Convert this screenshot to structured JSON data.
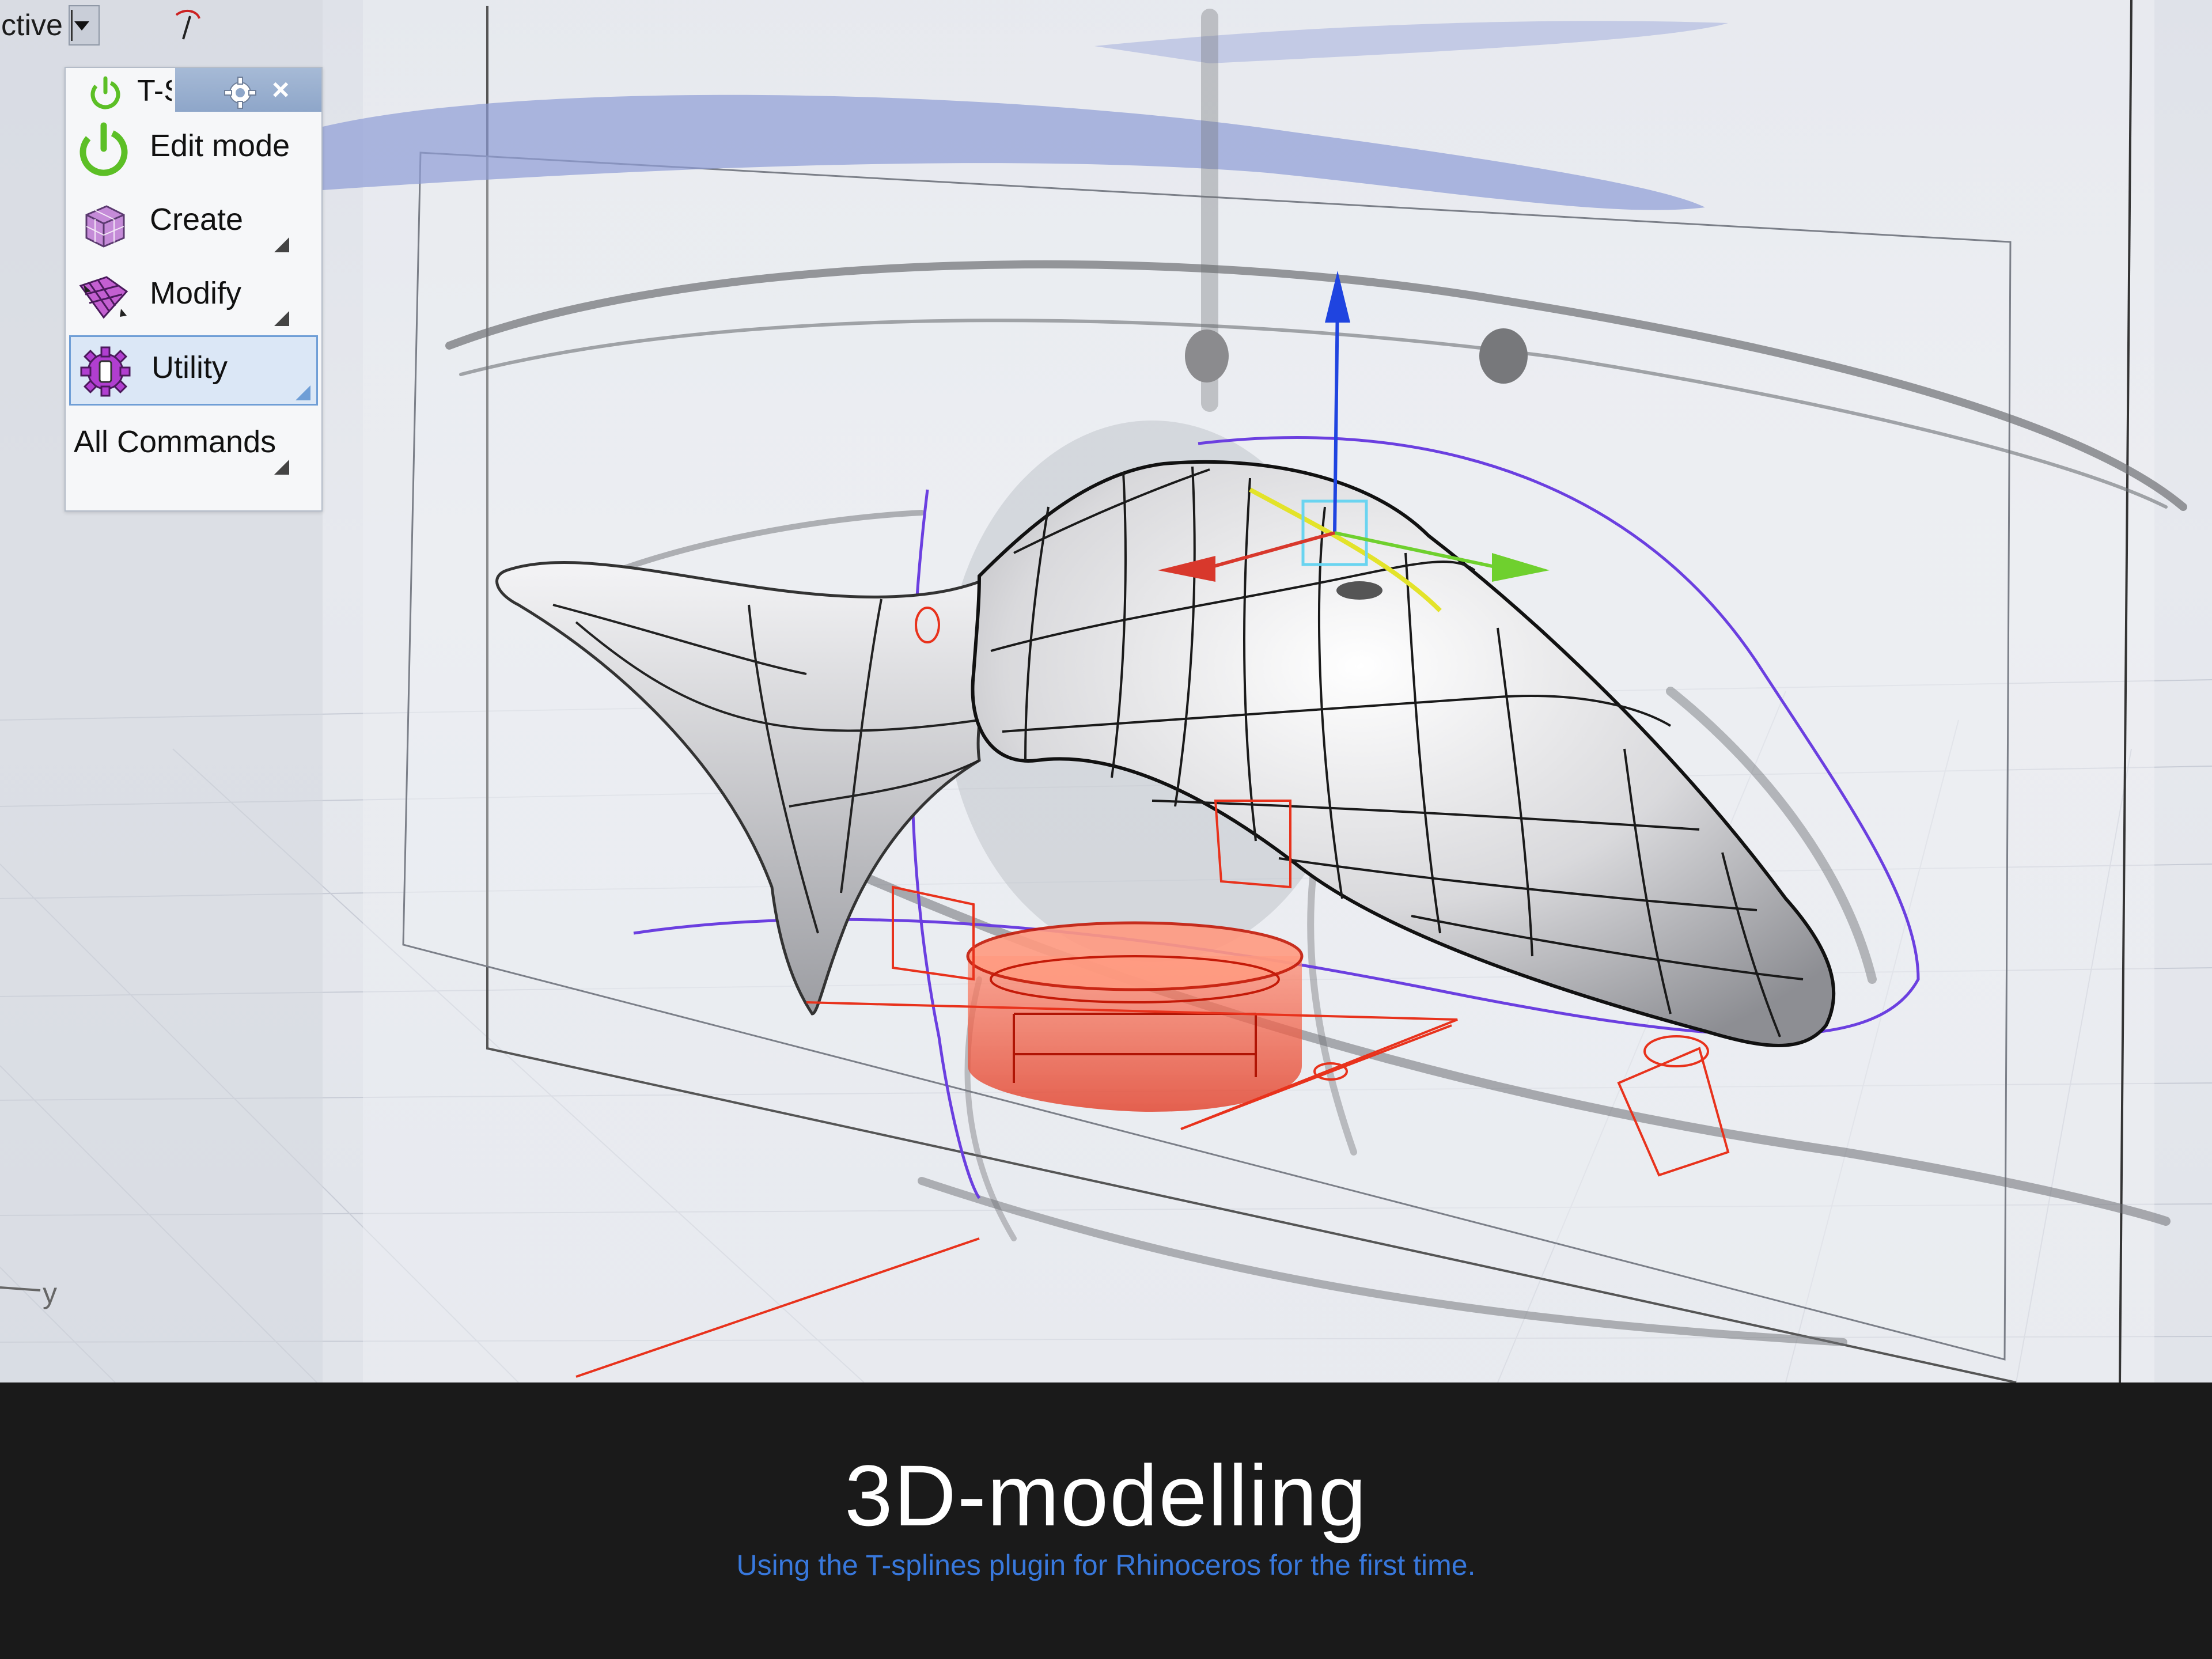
{
  "viewport": {
    "title_fragment": "ctive",
    "axis_label": "y"
  },
  "toolbar": {
    "title": "T-S",
    "close_symbol": "×",
    "items": [
      {
        "label": "Edit mode",
        "icon": "power-icon"
      },
      {
        "label": "Create",
        "icon": "create-box-icon"
      },
      {
        "label": "Modify",
        "icon": "modify-surface-icon"
      },
      {
        "label": "Utility",
        "icon": "utility-gear-icon"
      },
      {
        "label": "All Commands"
      }
    ]
  },
  "caption": {
    "title": "3D-modelling",
    "subtitle": "Using the T-splines plugin for Rhinoceros for the first time."
  },
  "colors": {
    "caption_bg": "#1a1a1a",
    "caption_title": "#ffffff",
    "caption_subtitle": "#3878dc",
    "gizmo_x": "#d8382c",
    "gizmo_y": "#6fd02e",
    "gizmo_z": "#1f44e0",
    "selection_red": "#e8321c",
    "curve_purple": "#6b3fe0"
  }
}
